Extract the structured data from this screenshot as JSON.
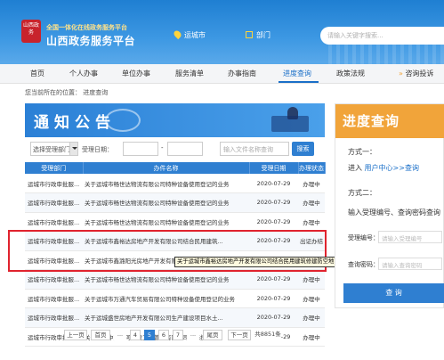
{
  "header": {
    "logo_seal": "山西政务",
    "logo_subtitle": "全国一体化在线政务服务平台",
    "logo_title": "山西政务服务平台",
    "location": "运城市",
    "department": "部门",
    "search_placeholder": "请输入关键字搜索..."
  },
  "nav": {
    "items": [
      "首页",
      "个人办事",
      "单位办事",
      "服务清单",
      "办事指南",
      "进度查询",
      "政策法规",
      "咨询投诉"
    ],
    "active": "进度查询",
    "active_color": "#1a6fc8"
  },
  "breadcrumb": "您当前所在的位置： 进度查询",
  "main": {
    "banner_title": "通知公告",
    "filters": {
      "department_select": "选择受理部门",
      "date_label": "受理日期：",
      "date_separator": "-",
      "keyword_placeholder": "输入文件名称查询",
      "search_button": "搜索"
    },
    "table": {
      "headers": [
        "受理部门",
        "办件名称",
        "受理日期",
        "办理状态"
      ],
      "rows": [
        [
          "运城市行政审批服...",
          "关于运城市畅世达物流有限公司特种设备使用登记的业务",
          "2020-07-29",
          "办理中"
        ],
        [
          "运城市行政审批服...",
          "关于运城市畅世达物流有限公司特种设备使用登记的业务",
          "2020-07-29",
          "办理中"
        ],
        [
          "运城市行政审批服...",
          "关于运城市畅世达物流有限公司特种设备使用登记的业务",
          "2020-07-29",
          "办理中"
        ],
        [
          "运城市行政审批服...",
          "关于运城市鑫裕达房地产开发有限公司结合民用建筑...",
          "2020-07-29",
          "出证办结"
        ],
        [
          "运城市行政审批服...",
          "关于运城市鑫潞阳光房地产开发有限公司结合民用建筑...",
          "2020-07-29",
          "出证办结"
        ],
        [
          "运城市行政审批服...",
          "关于运城市畅世达物流有限公司特种设备使用登记的业务",
          "2020-07-29",
          "办理中"
        ],
        [
          "运城市行政审批服...",
          "关于运城市万通汽车贸易有限公司特种设备使用登记的业务",
          "2020-07-29",
          "办理中"
        ],
        [
          "运城市行政审批服...",
          "关于运城盛世房地产开发有限公司生产建设项目水土...",
          "2020-07-29",
          "办理中"
        ],
        [
          "运城市行政审批服...",
          "关于运城中建兴河建设工程管理有限公司招标控制价...",
          "2020-07-29",
          "办理中"
        ]
      ]
    },
    "tooltip": "关于运城市鑫裕达房地产开发有限公司结合民用建筑修建防空地下室审批的业务",
    "pager": {
      "prev": "上一页",
      "first": "首页",
      "ellipsis": "...",
      "pages": [
        "4",
        "5",
        "6",
        "7"
      ],
      "current": "5",
      "last": "尾页",
      "next": "下一页",
      "total": "共8851条"
    }
  },
  "sidebar": {
    "title": "进度查询",
    "method1_label": "方式一：",
    "method1_text": "进入",
    "method1_link": "用户中心>>查询",
    "method2_label": "方式二：",
    "method2_text": "输入受理编号、查询密码查询",
    "accept_no_label": "受理编号：",
    "accept_no_placeholder": "请输入受理编号",
    "password_label": "查询密码：",
    "password_placeholder": "请输入查询密码",
    "query_button": "查 询"
  },
  "colors": {
    "header_blue": "#1f7fd2",
    "table_header": "#2f7fd1",
    "highlight_border": "#e0232e",
    "sidebar_banner": "#f1a43a"
  }
}
